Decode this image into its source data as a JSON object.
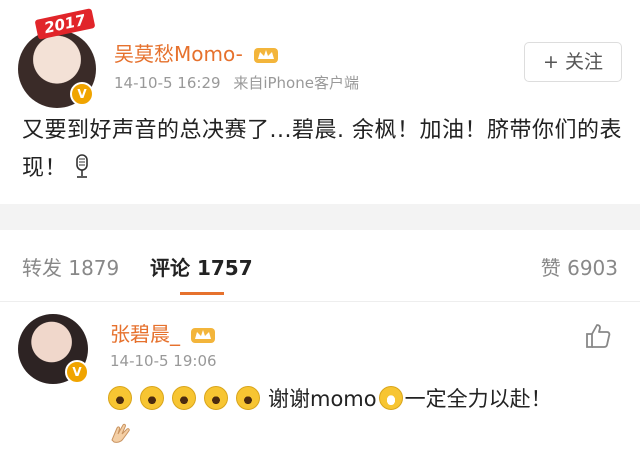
{
  "post": {
    "badge": "2017",
    "user": "吴莫愁Momo-",
    "verified_mark": "V",
    "time": "14-10-5 16:29",
    "source": "来自iPhone客户端",
    "follow_label": "+ 关注",
    "text": "又要到好声音的总决赛了...碧晨. 余枫！加油！脐带你们的表现！"
  },
  "tabs": {
    "repost": "转发 1879",
    "comment": "评论 1757",
    "like": "赞 6903"
  },
  "reply": {
    "user": "张碧晨_",
    "verified_mark": "V",
    "time": "14-10-5 19:06",
    "text_a": "谢谢momo",
    "text_b": "一定全力以赴！"
  },
  "icons": {
    "crown": "crown-icon",
    "mic": "microphone-icon",
    "thumb": "thumbs-up-icon",
    "emoji": "laughing-emoji-icon",
    "hand": "clapping-hands-icon"
  },
  "colors": {
    "username": "#e6712d",
    "meta": "#999999",
    "vip_badge": "#e1252a",
    "verified": "#f0a400"
  }
}
